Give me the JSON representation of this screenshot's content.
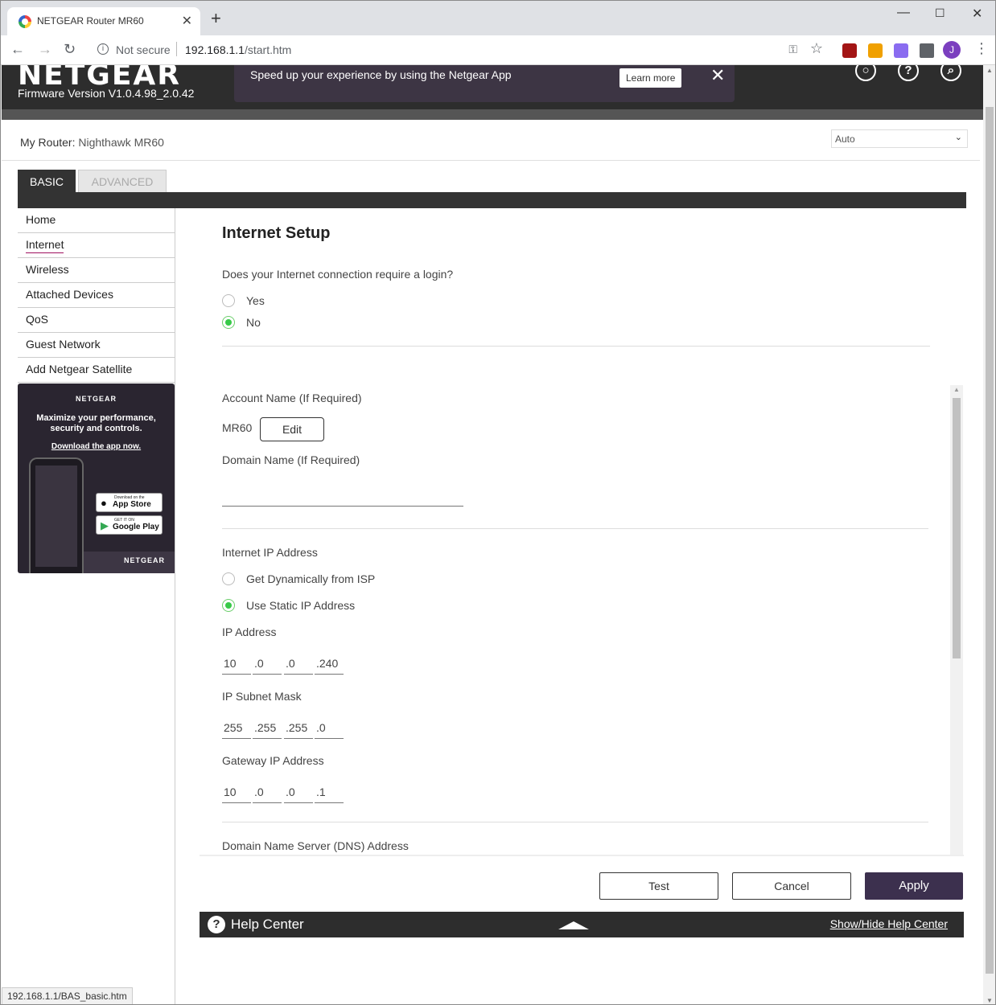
{
  "browser": {
    "tab_title": "NETGEAR Router MR60",
    "tab_close": "✕",
    "new_tab": "+",
    "security": "Not secure",
    "url_host": "192.168.1.1",
    "url_path": "/start.htm",
    "profile_initial": "J",
    "status_url": "192.168.1.1/BAS_basic.htm"
  },
  "header": {
    "logo": "NETGEAR",
    "firmware": "Firmware Version V1.0.4.98_2.0.42",
    "banner_text": "Speed up your experience by using the Netgear App",
    "banner_button": "Learn more",
    "banner_close": "✕"
  },
  "router": {
    "label": "My Router: ",
    "name": "Nighthawk MR60",
    "language": "Auto"
  },
  "tabs": {
    "basic": "BASIC",
    "advanced": "ADVANCED"
  },
  "sidebar": {
    "items": [
      {
        "label": "Home"
      },
      {
        "label": "Internet"
      },
      {
        "label": "Wireless"
      },
      {
        "label": "Attached Devices"
      },
      {
        "label": "QoS"
      },
      {
        "label": "Guest Network"
      },
      {
        "label": "Add Netgear Satellite"
      }
    ]
  },
  "promo": {
    "brand": "NETGEAR",
    "message": "Maximize your performance, security and controls.",
    "download": "Download the app now.",
    "appstore_small": "Download on the",
    "appstore_big": "App Store",
    "googleplay_small": "GET IT ON",
    "googleplay_big": "Google Play"
  },
  "main": {
    "title": "Internet Setup",
    "login_question": "Does your Internet connection require a login?",
    "login_yes": "Yes",
    "login_no": "No",
    "account_name_label": "Account Name  (If Required)",
    "account_name_value": "MR60",
    "edit_button": "Edit",
    "domain_name_label": "Domain Name  (If Required)",
    "ip_section_label": "Internet IP Address",
    "ip_dynamic": "Get Dynamically from ISP",
    "ip_static": "Use Static IP Address",
    "ip_address_label": "IP Address",
    "ip_address": [
      "10",
      ".0",
      ".0",
      ".240"
    ],
    "subnet_label": "IP Subnet Mask",
    "subnet": [
      "255",
      ".255",
      ".255",
      ".0"
    ],
    "gateway_label": "Gateway IP Address",
    "gateway": [
      "10",
      ".0",
      ".0",
      ".1"
    ],
    "dns_label": "Domain Name Server (DNS) Address"
  },
  "buttons": {
    "test": "Test",
    "cancel": "Cancel",
    "apply": "Apply"
  },
  "help": {
    "title": "Help Center",
    "toggle": "Show/Hide Help Center"
  },
  "colors": {
    "apply_bg": "#3c304e",
    "radio_on": "#38c948",
    "header_bg": "#2d2d2d"
  }
}
